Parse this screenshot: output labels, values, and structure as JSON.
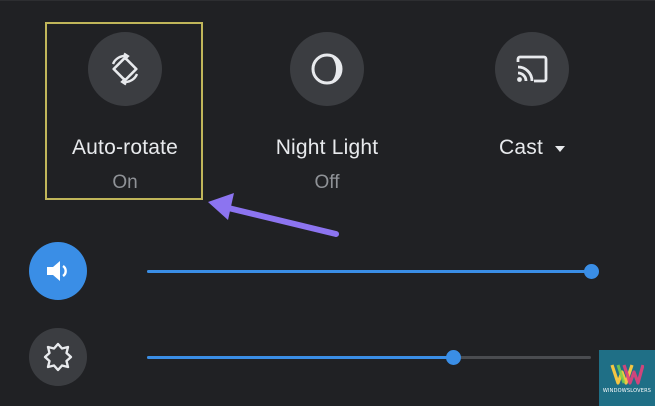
{
  "tiles": [
    {
      "label": "Auto-rotate",
      "status": "On",
      "icon": "screen-rotation-icon"
    },
    {
      "label": "Night Light",
      "status": "Off",
      "icon": "night-light-icon"
    },
    {
      "label": "Cast",
      "status": "",
      "icon": "cast-icon",
      "has_dropdown": true
    }
  ],
  "sliders": {
    "volume": {
      "icon": "volume-icon",
      "level": 1.0
    },
    "brightness": {
      "icon": "brightness-icon",
      "level": 0.69
    }
  },
  "annotation": {
    "highlight_color": "#c0b65a",
    "arrow_color": "#8c74f0"
  },
  "colors": {
    "background": "#202124",
    "accent": "#3a8ee6",
    "tile_button": "#3b3d41",
    "label_text": "#e8eaed",
    "status_text": "#8f9297"
  },
  "watermark": {
    "text": "WINDOWSLOVERS"
  }
}
